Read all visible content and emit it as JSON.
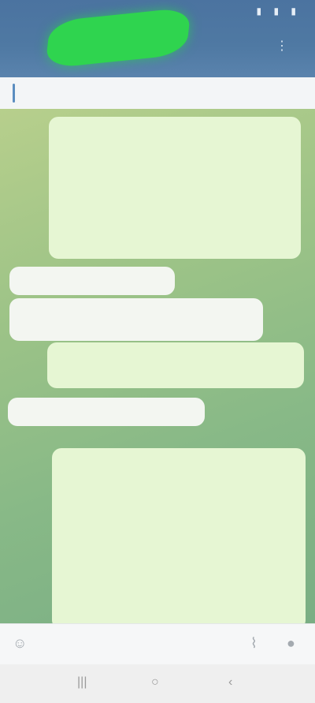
{
  "status": {
    "time": "",
    "icons": "▮ ▮ ▮"
  },
  "header": {
    "icons": "⋮"
  },
  "pinned": {
    "text": ""
  },
  "messages": [
    {
      "text": ""
    },
    {
      "text": ""
    },
    {
      "text": ""
    },
    {
      "text": ""
    },
    {
      "text": ""
    }
  ],
  "input": {
    "placeholder": ""
  },
  "nav": {
    "recent": "|||",
    "home": "○",
    "back": "‹"
  },
  "colors": {
    "header": "#4f79a3",
    "redaction": "#2fd44f",
    "bubble_out": "#e6f6d3",
    "bubble_in": "#f3f6f1"
  }
}
